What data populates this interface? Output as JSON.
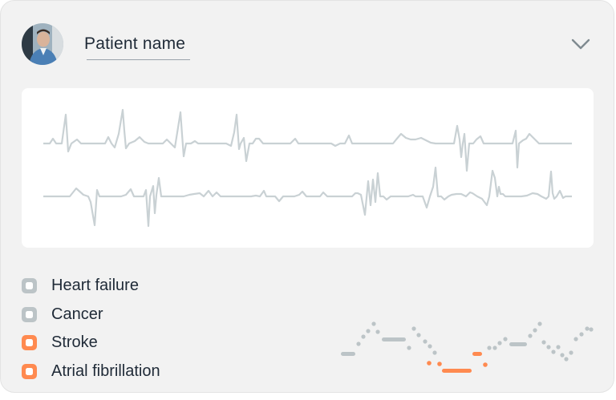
{
  "patient": {
    "name": "Patient name"
  },
  "icons": {
    "avatar": "patient-avatar",
    "expand": "chevron-down-icon"
  },
  "colors": {
    "card_bg": "#f2f2f2",
    "gray_marker": "#bcc4c7",
    "orange_marker": "#ff8a50",
    "ecg_line": "#c9d1d4",
    "text": "#1f2a37"
  },
  "conditions": [
    {
      "label": "Heart failure",
      "color": "#bcc4c7"
    },
    {
      "label": "Cancer",
      "color": "#bcc4c7"
    },
    {
      "label": "Stroke",
      "color": "#ff8a50"
    },
    {
      "label": "Atrial fibrillation",
      "color": "#ff8a50"
    }
  ]
}
